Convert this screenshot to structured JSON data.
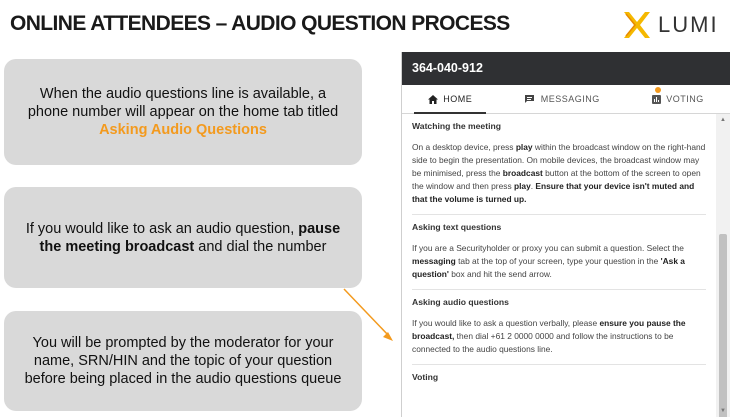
{
  "slide": {
    "title": "ONLINE ATTENDEES – AUDIO QUESTION PROCESS",
    "logo_text": "LUMI"
  },
  "boxes": {
    "box1": {
      "text_before": "When the audio questions line is available, a phone number will appear on the home tab titled ",
      "highlight": "Asking Audio Questions"
    },
    "box2": {
      "text_before": "If you would like to ask an audio question, ",
      "bold": "pause the meeting broadcast",
      "text_after": " and dial the number"
    },
    "box3": {
      "text": "You will be prompted by the moderator for your name, SRN/HIN and the topic of your question before being placed in the audio questions queue"
    }
  },
  "panel": {
    "meeting_id": "364-040-912",
    "tabs": [
      {
        "label": "HOME",
        "icon": "home-icon"
      },
      {
        "label": "MESSAGING",
        "icon": "messaging-icon"
      },
      {
        "label": "VOTING",
        "icon": "voting-icon"
      }
    ],
    "sections": {
      "watching": {
        "heading": "Watching the meeting",
        "p1": "On a desktop device, press ",
        "b1": "play",
        "p2": " within the broadcast window on the right-hand side to begin the presentation. On mobile devices, the broadcast window may be minimised, press the ",
        "b2": "broadcast",
        "p3": " button at the bottom of the screen to open the window and then press ",
        "b3": "play",
        "p4": ". ",
        "b4": "Ensure that your device isn't muted and that the volume is turned up."
      },
      "text_q": {
        "heading": "Asking text questions",
        "p1": "If you are a Securityholder or proxy you can submit a question. Select the ",
        "b1": "messaging",
        "p2": " tab at the top of your screen, type your question in the ",
        "b2": "'Ask a question'",
        "p3": " box and hit the send arrow."
      },
      "audio_q": {
        "heading": "Asking audio questions",
        "p1": "If you would like to ask a question verbally, please ",
        "b1": "ensure you pause the broadcast,",
        "p2": " then dial +61 2 0000 0000 and follow the instructions to be connected to the audio questions line."
      },
      "voting": {
        "heading": "Voting"
      }
    }
  },
  "colors": {
    "accent_orange": "#f39a1e",
    "header_dark": "#2f3033",
    "box_grey": "#d9d9d9"
  }
}
